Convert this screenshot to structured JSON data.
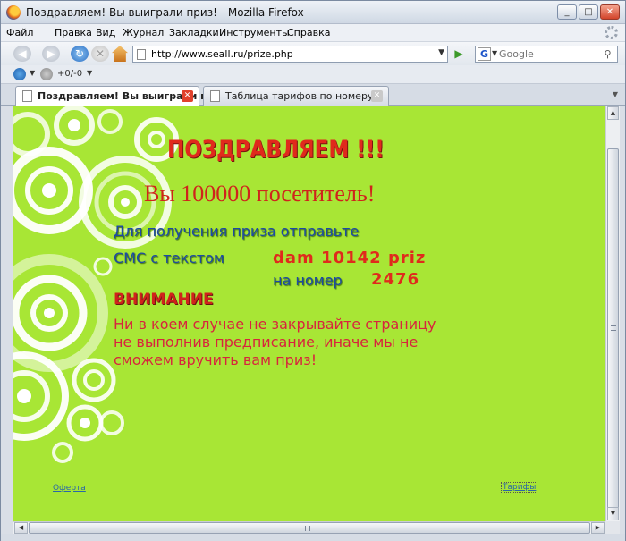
{
  "window": {
    "title": "Поздравляем! Вы выиграли приз! - Mozilla Firefox",
    "controls": {
      "minimize": "_",
      "maximize": "□",
      "close": "✕"
    }
  },
  "menu": [
    "Файл",
    "Правка",
    "Вид",
    "Журнал",
    "Закладки",
    "Инструменты",
    "Справка"
  ],
  "nav": {
    "url": "http://www.seall.ru/prize.php",
    "search_placeholder": "Google",
    "search_engine": "G"
  },
  "extension": {
    "score": "+0/-0"
  },
  "tabs": [
    {
      "label": "Поздравляем! Вы выиграли пр...",
      "active": true
    },
    {
      "label": "Таблица тарифов по номеру",
      "active": false
    }
  ],
  "content": {
    "headline": "ПОЗДРАВЛЯЕМ !!!",
    "visitor": "Вы 100000 посетитель!",
    "instruction_line1": "Для получения приза отправьте",
    "instruction_line2": "СМС с текстом",
    "sms_code": "dam 10142 priz",
    "instruction_line3": "на номер",
    "sms_number": "2476",
    "warning_title": "ВНИМАНИЕ",
    "warning_text": "Ни в коем случае не закрывайте страницу не выполнив предписание, иначе мы не сможем вручить вам приз!",
    "link_offer": "Оферта",
    "link_tariffs": "Тарифы"
  },
  "colors": {
    "page_background": "#a8e635",
    "headline_red": "#e02a1c",
    "instruction_blue": "#1c4aa5",
    "warning_pink": "#d8243d"
  },
  "icons": [
    "firefox-icon",
    "back-icon",
    "forward-icon",
    "reload-icon",
    "stop-icon",
    "home-icon",
    "page-icon",
    "go-icon",
    "google-icon",
    "search-icon",
    "gear-icon",
    "tab-close-icon"
  ]
}
